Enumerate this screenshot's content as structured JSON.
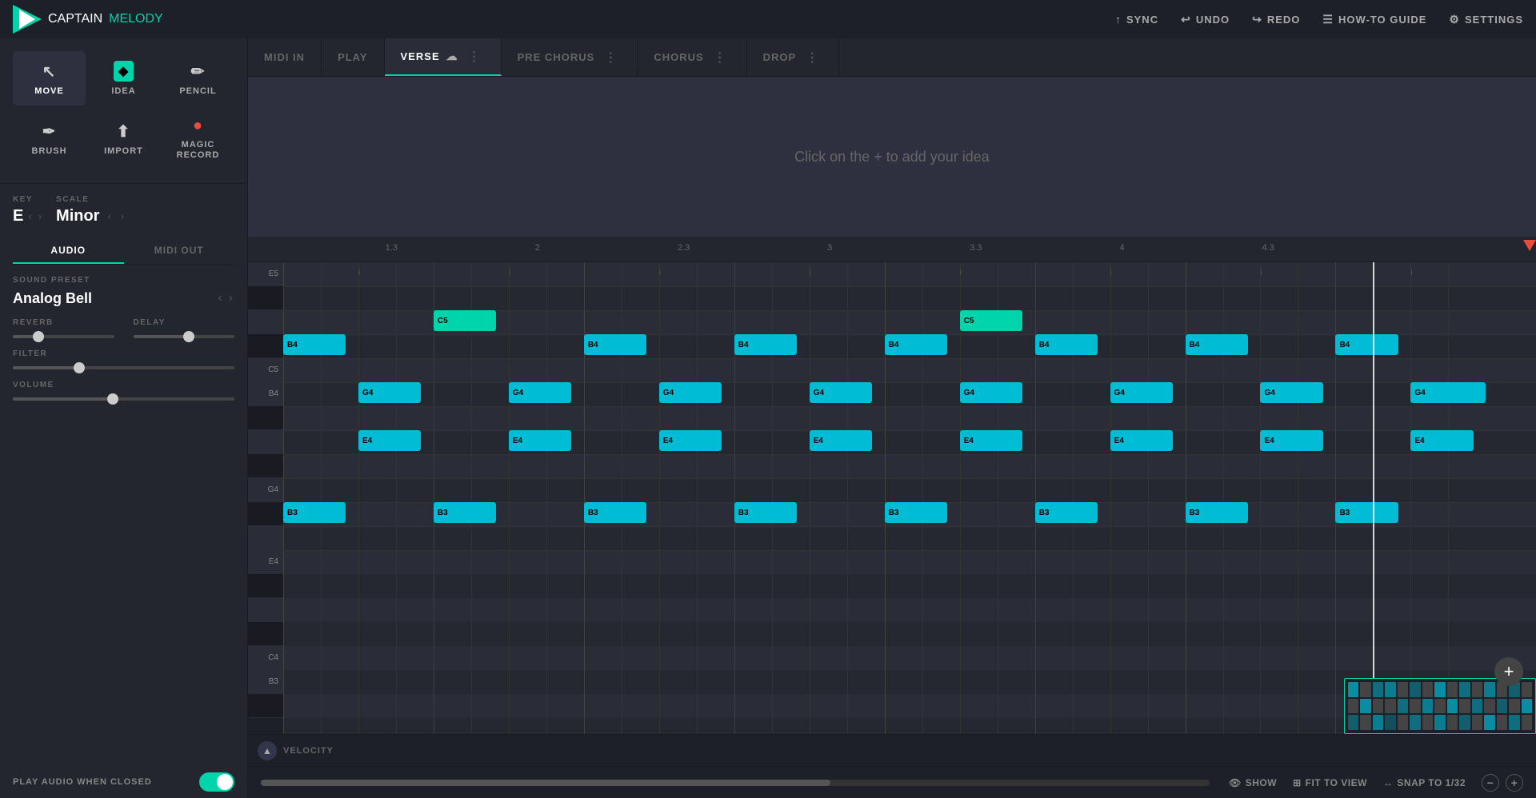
{
  "app": {
    "title_captain": "CAPTAIN",
    "title_melody": "MELODY"
  },
  "topbar": {
    "sync_label": "SYNC",
    "undo_label": "UNDO",
    "redo_label": "REDO",
    "howto_label": "HOW-TO GUIDE",
    "settings_label": "SETTINGS"
  },
  "tools": [
    {
      "id": "move",
      "label": "MOVE",
      "icon": "↖",
      "active": true
    },
    {
      "id": "idea",
      "label": "IDEA",
      "icon": "◆",
      "active": false
    },
    {
      "id": "pencil",
      "label": "PENCIL",
      "icon": "✏",
      "active": false
    },
    {
      "id": "brush",
      "label": "BRUSH",
      "icon": "✒",
      "active": false
    },
    {
      "id": "import",
      "label": "IMPORT",
      "icon": "⬆",
      "active": false
    },
    {
      "id": "magic-record",
      "label": "MAGIC RECORD",
      "icon": "●",
      "active": false
    }
  ],
  "key": {
    "label": "KEY",
    "value": "E"
  },
  "scale": {
    "label": "SCALE",
    "value": "Minor"
  },
  "tabs": {
    "audio_label": "AUDIO",
    "midi_out_label": "MIDI OUT",
    "active": "audio"
  },
  "sound_preset": {
    "label": "SOUND PRESET",
    "value": "Analog Bell"
  },
  "reverb": {
    "label": "REVERB",
    "value": 25
  },
  "delay": {
    "label": "DELAY",
    "value": 55
  },
  "filter": {
    "label": "FILTER",
    "value": 30
  },
  "volume": {
    "label": "VOLUME",
    "value": 45
  },
  "play_audio_closed": {
    "label": "PLAY AUDIO WHEN CLOSED",
    "value": true
  },
  "section_tabs": [
    {
      "id": "midi-in",
      "label": "MIDI IN",
      "active": false
    },
    {
      "id": "play",
      "label": "PLAY",
      "active": false
    },
    {
      "id": "verse",
      "label": "VERSE",
      "active": true
    },
    {
      "id": "pre-chorus",
      "label": "PRE CHORUS",
      "active": false
    },
    {
      "id": "chorus",
      "label": "CHORUS",
      "active": false
    },
    {
      "id": "drop",
      "label": "DROP",
      "active": false
    }
  ],
  "verse_empty_hint": "Click on the + to add your idea",
  "timeline": {
    "marks": [
      "1.3",
      "2",
      "2.3",
      "3",
      "3.3",
      "4",
      "4.3"
    ]
  },
  "piano_keys": [
    {
      "id": "E5",
      "label": "E5",
      "type": "white"
    },
    {
      "id": "Eb5",
      "label": "",
      "type": "black"
    },
    {
      "id": "D5",
      "label": "",
      "type": "white"
    },
    {
      "id": "C#5",
      "label": "",
      "type": "black"
    },
    {
      "id": "C5",
      "label": "C5",
      "type": "white"
    },
    {
      "id": "B4",
      "label": "B4",
      "type": "white"
    },
    {
      "id": "Bb4",
      "label": "",
      "type": "black"
    },
    {
      "id": "A4",
      "label": "",
      "type": "white"
    },
    {
      "id": "Ab4",
      "label": "",
      "type": "black"
    },
    {
      "id": "G4",
      "label": "G4",
      "type": "white"
    },
    {
      "id": "F#4",
      "label": "",
      "type": "black"
    },
    {
      "id": "F4",
      "label": "",
      "type": "white"
    },
    {
      "id": "E4",
      "label": "E4",
      "type": "white"
    },
    {
      "id": "Eb4",
      "label": "",
      "type": "black"
    },
    {
      "id": "D4",
      "label": "",
      "type": "white"
    },
    {
      "id": "C#4",
      "label": "",
      "type": "black"
    },
    {
      "id": "C4",
      "label": "C4",
      "type": "white"
    },
    {
      "id": "B3",
      "label": "B3",
      "type": "white"
    },
    {
      "id": "Bb3",
      "label": "",
      "type": "black"
    }
  ],
  "notes": [
    {
      "pitch": "B4",
      "col": 0,
      "color": "cyan"
    },
    {
      "pitch": "E4",
      "col": 1,
      "color": "cyan"
    },
    {
      "pitch": "G4",
      "col": 2,
      "color": "cyan"
    },
    {
      "pitch": "C5",
      "col": 3,
      "color": "teal"
    },
    {
      "pitch": "B4",
      "col": 4,
      "color": "cyan"
    },
    {
      "pitch": "B3",
      "col": 4,
      "color": "cyan"
    },
    {
      "pitch": "E4",
      "col": 5,
      "color": "cyan"
    },
    {
      "pitch": "G4",
      "col": 6,
      "color": "cyan"
    },
    {
      "pitch": "B4",
      "col": 7,
      "color": "cyan"
    },
    {
      "pitch": "G4",
      "col": 8,
      "color": "cyan"
    },
    {
      "pitch": "E4",
      "col": 9,
      "color": "cyan"
    },
    {
      "pitch": "B3",
      "col": 10,
      "color": "cyan"
    }
  ],
  "velocity_label": "VELOCITY",
  "bottom": {
    "show_label": "SHOW",
    "fit_label": "FIT TO VIEW",
    "snap_label": "SNAP TO 1/32"
  },
  "colors": {
    "accent": "#00d4aa",
    "note_cyan": "#00bcd4",
    "note_teal": "#00d4aa",
    "bg_dark": "#1e2029",
    "bg_mid": "#23252f",
    "bg_main": "#2a2d38"
  }
}
